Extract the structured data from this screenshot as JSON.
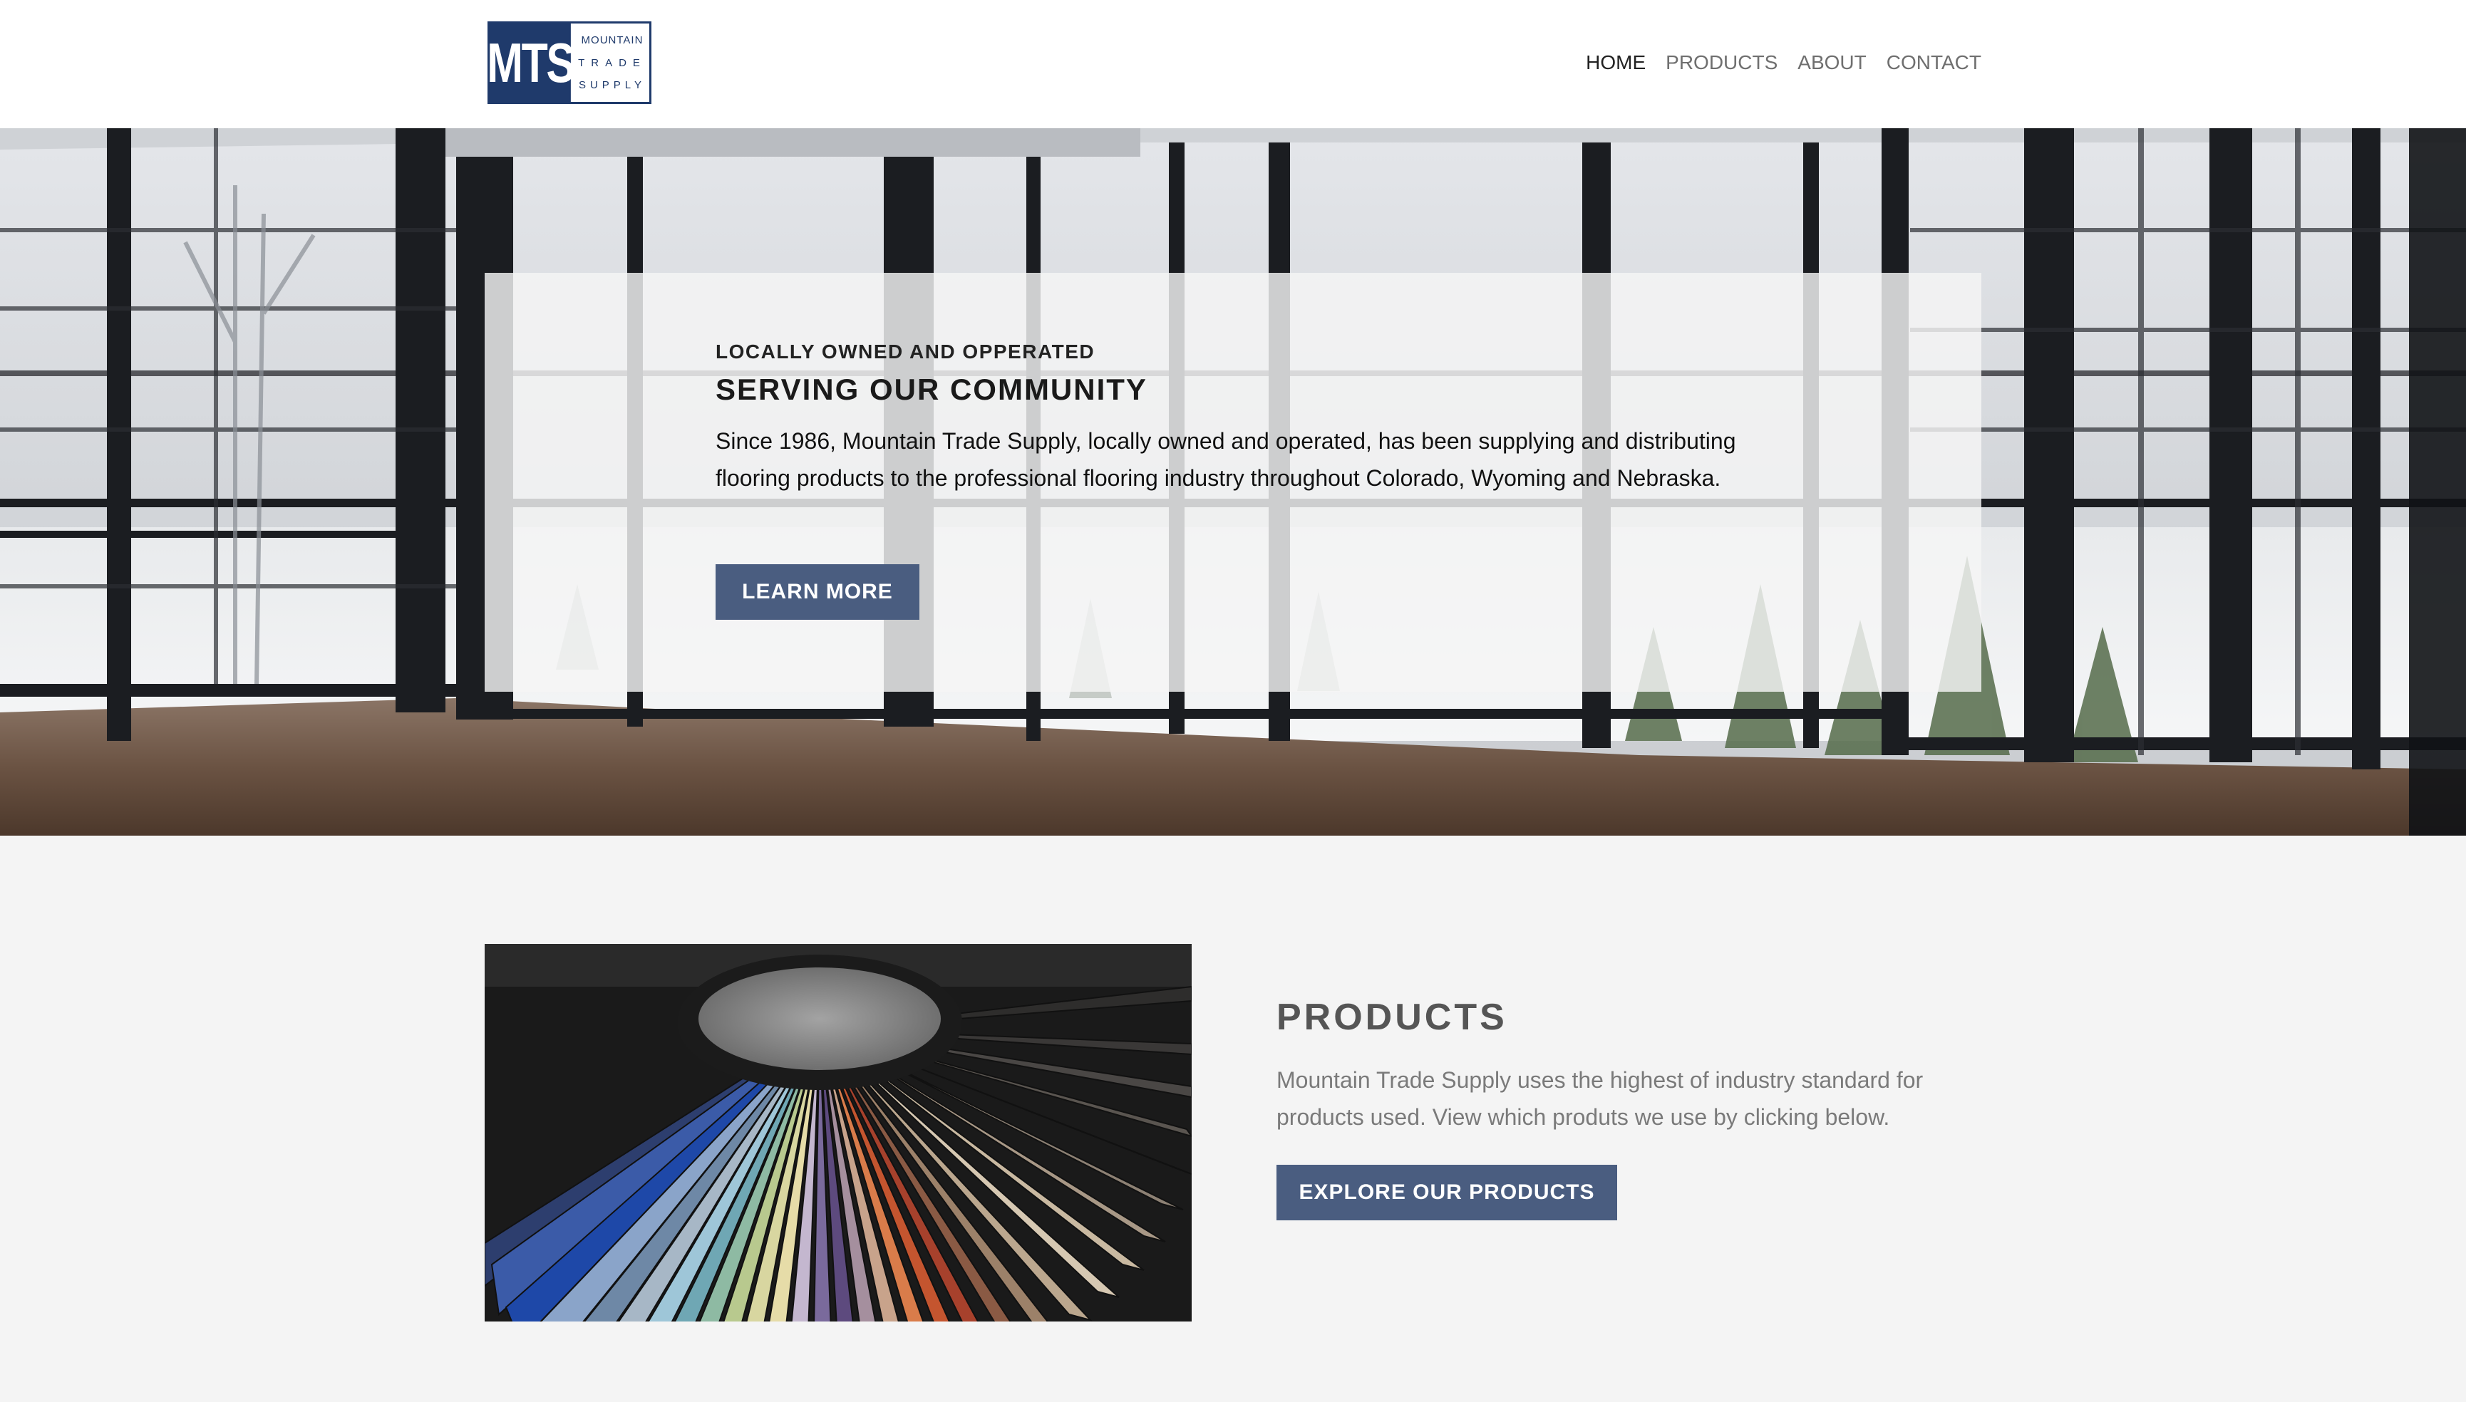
{
  "header": {
    "logo": {
      "mark": "MTS",
      "lines": [
        "MOUNTAIN",
        "TRADE",
        "SUPPLY"
      ]
    },
    "nav": [
      {
        "label": "HOME",
        "active": true
      },
      {
        "label": "PRODUCTS",
        "active": false
      },
      {
        "label": "ABOUT",
        "active": false
      },
      {
        "label": "CONTACT",
        "active": false
      }
    ]
  },
  "hero": {
    "eyebrow": "LOCALLY OWNED AND OPPERATED",
    "title": "SERVING OUR COMMUNITY",
    "body": "Since 1986, Mountain Trade Supply, locally owned and operated, has been supplying and distributing flooring products to the professional flooring industry throughout Colorado, Wyoming and Nebraska.",
    "button_label": "LEARN MORE",
    "image_icon": "sunroom-windows-photo"
  },
  "products": {
    "image_icon": "color-swatch-fan-photo",
    "heading": "PRODUCTS",
    "body": "Mountain Trade Supply uses the highest of industry standard for products used. View which produts we use by clicking below.",
    "button_label": "EXPLORE OUR PRODUCTS"
  },
  "colors": {
    "brand_navy": "#1f3a6b",
    "button": "#4a5d80",
    "background": "#f4f4f4"
  }
}
